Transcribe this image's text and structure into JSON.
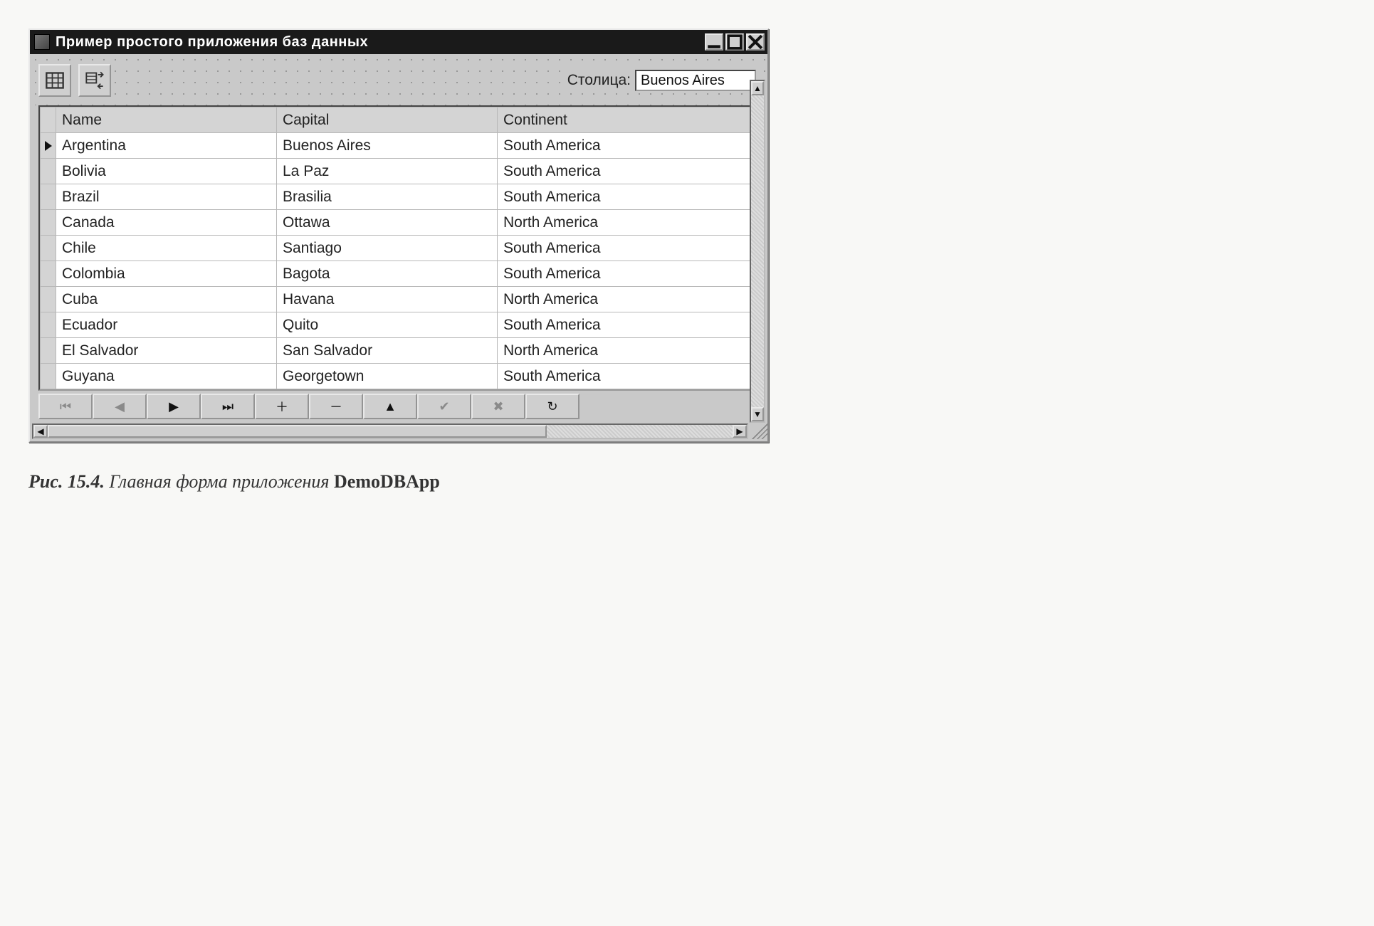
{
  "window": {
    "title": "Пример простого приложения баз данных"
  },
  "toolbar": {
    "capital_label": "Столица:",
    "capital_value": "Buenos Aires"
  },
  "grid": {
    "columns": [
      "Name",
      "Capital",
      "Continent"
    ],
    "active_row_index": 0,
    "rows": [
      {
        "name": "Argentina",
        "capital": "Buenos Aires",
        "continent": "South America"
      },
      {
        "name": "Bolivia",
        "capital": "La Paz",
        "continent": "South America"
      },
      {
        "name": "Brazil",
        "capital": "Brasilia",
        "continent": "South America"
      },
      {
        "name": "Canada",
        "capital": "Ottawa",
        "continent": "North America"
      },
      {
        "name": "Chile",
        "capital": "Santiago",
        "continent": "South America"
      },
      {
        "name": "Colombia",
        "capital": "Bagota",
        "continent": "South America"
      },
      {
        "name": "Cuba",
        "capital": "Havana",
        "continent": "North America"
      },
      {
        "name": "Ecuador",
        "capital": "Quito",
        "continent": "South America"
      },
      {
        "name": "El Salvador",
        "capital": "San Salvador",
        "continent": "North America"
      },
      {
        "name": "Guyana",
        "capital": "Georgetown",
        "continent": "South America"
      }
    ]
  },
  "navigator": {
    "buttons": [
      {
        "id": "first",
        "glyph": "⏮",
        "enabled": false
      },
      {
        "id": "prior",
        "glyph": "◀",
        "enabled": false
      },
      {
        "id": "next",
        "glyph": "▶",
        "enabled": true
      },
      {
        "id": "last",
        "glyph": "⏭",
        "enabled": true
      },
      {
        "id": "insert",
        "glyph": "＋",
        "enabled": true
      },
      {
        "id": "delete",
        "glyph": "－",
        "enabled": true
      },
      {
        "id": "edit",
        "glyph": "▲",
        "enabled": true
      },
      {
        "id": "post",
        "glyph": "✔",
        "enabled": false
      },
      {
        "id": "cancel",
        "glyph": "✖",
        "enabled": false
      },
      {
        "id": "refresh",
        "glyph": "↻",
        "enabled": true
      }
    ]
  },
  "caption": {
    "fig_number": "Рис. 15.4.",
    "text": " Главная форма приложения ",
    "app_name": "DemoDBApp"
  }
}
